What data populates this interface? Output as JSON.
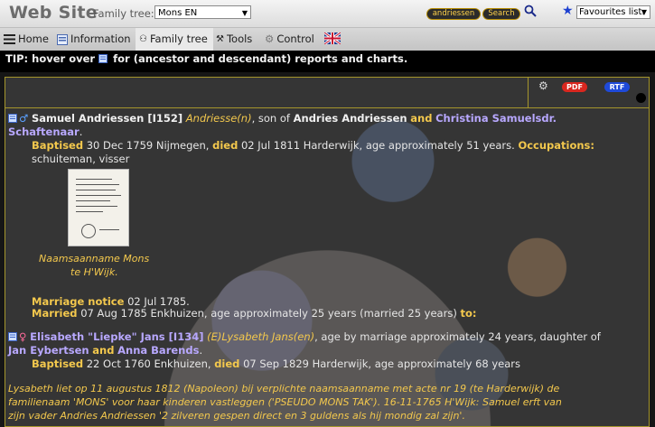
{
  "header": {
    "site_title": "Web Site",
    "tree_label": "Family tree:",
    "tree_value": "Mons EN",
    "search_value": "andriessen",
    "search_button": "Search",
    "favourites_value": "Favourites list:"
  },
  "menu": {
    "home": "Home",
    "information": "Information",
    "family_tree": "Family tree",
    "tools": "Tools",
    "control": "Control"
  },
  "tip": {
    "prefix": "TIP: hover over",
    "suffix": "for (ancestor and descendant) reports and charts."
  },
  "toolbar": {
    "pdf": "PDF",
    "rtf": "RTF"
  },
  "person1": {
    "name": "Samuel Andriessen [I152]",
    "alias": "Andriesse(n)",
    "son_of": ", son of",
    "father": "Andries Andriessen",
    "and": "and",
    "mother_line1": "Christina Samuelsdr.",
    "mother_line2": "Schaftenaar",
    "period": ".",
    "baptised_label": "Baptised",
    "baptised_text": "30 Dec 1759 Nijmegen,",
    "died_label": "died",
    "died_text": "02 Jul 1811 Harderwijk, age approximately 51 years.",
    "occupations_label": "Occupations:",
    "occupations": "schuiteman, visser",
    "caption_line1": "Naamsaanname Mons",
    "caption_line2": "te H'Wijk."
  },
  "marriage": {
    "notice_label": "Marriage notice",
    "notice_text": "02 Jul 1785.",
    "married_label": "Married",
    "married_text": "07 Aug 1785 Enkhuizen, age approximately 25 years (married 25 years)",
    "to_label": "to:"
  },
  "person2": {
    "name": "Elisabeth \"Liepke\" Jans [I134]",
    "alias": "(E)Lysabeth Jans(en)",
    "rest": ", age by marriage approximately 24 years, daughter of",
    "father": "Jan Eybertsen",
    "and": "and",
    "mother": "Anna Barends",
    "period": ".",
    "baptised_label": "Baptised",
    "baptised_text": "22 Oct 1760 Enkhuizen,",
    "died_label": "died",
    "died_text": "07 Sep 1829 Harderwijk, age approximately 68 years"
  },
  "note": {
    "line1": "Lysabeth liet op 11 augustus 1812 (Napoleon) bij verplichte naamsaanname met acte nr 19 (te Harderwijk) de",
    "line2": "familienaam 'MONS' voor haar kinderen vastleggen ('PSEUDO MONS TAK'). 16-11-1765 H'Wijk: Samuel erft van",
    "line3": "zijn vader Andries Andriessen '2 zilveren gespen direct en 3 guldens als hij mondig zal zijn'."
  },
  "colors": {
    "gold": "#f3c84d",
    "lilac": "#b8a8ff",
    "pdf": "#d9271f",
    "rtf": "#1f4ad9"
  }
}
